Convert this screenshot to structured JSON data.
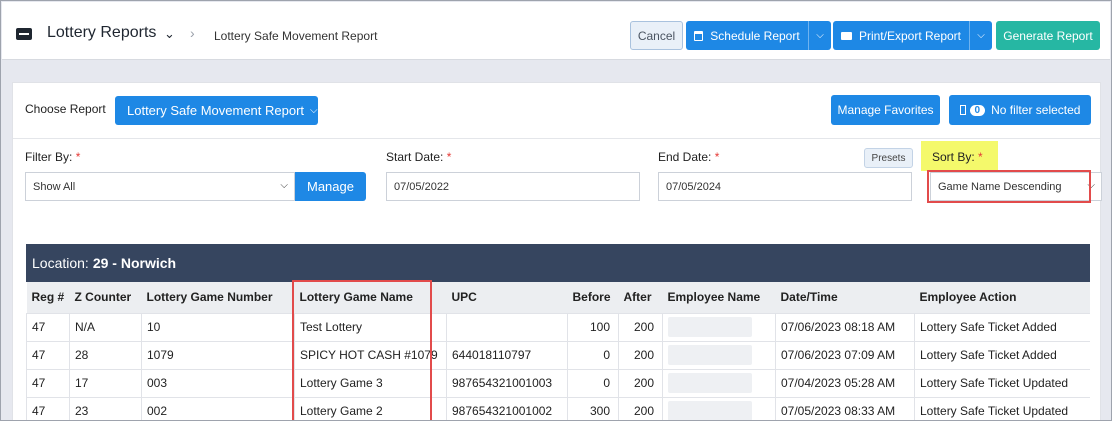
{
  "header": {
    "app_title": "Lottery Reports",
    "breadcrumb": "Lottery Safe Movement Report",
    "cancel_label": "Cancel",
    "schedule_label": "Schedule Report",
    "print_label": "Print/Export Report",
    "generate_label": "Generate Report"
  },
  "toolbar": {
    "choose_label": "Choose Report",
    "report_selected": "Lottery Safe Movement Report",
    "favorites_label": "Manage Favorites",
    "filter_count": "0",
    "filter_label": "No filter selected"
  },
  "filters": {
    "filter_by_label": "Filter By:",
    "filter_by_value": "Show All",
    "manage_label": "Manage",
    "start_label": "Start Date:",
    "start_value": "07/05/2022",
    "end_label": "End Date:",
    "end_value": "07/05/2024",
    "presets_label": "Presets",
    "sort_label": "Sort By:",
    "sort_value": "Game Name Descending",
    "required_mark": "*"
  },
  "table": {
    "location_label": "Location:",
    "location_value": "29 - Norwich",
    "columns": [
      "Reg #",
      "Z Counter",
      "Lottery Game Number",
      "Lottery Game Name",
      "UPC",
      "Before",
      "After",
      "Employee Name",
      "Date/Time",
      "Employee Action"
    ],
    "rows": [
      [
        "47",
        "N/A",
        "10",
        "Test Lottery",
        "",
        "100",
        "200",
        "",
        "07/06/2023 08:18 AM",
        "Lottery Safe Ticket Added"
      ],
      [
        "47",
        "28",
        "1079",
        "SPICY HOT CASH #1079",
        "644018110797",
        "0",
        "200",
        "",
        "07/06/2023 07:09 AM",
        "Lottery Safe Ticket Added"
      ],
      [
        "47",
        "17",
        "003",
        "Lottery Game 3",
        "987654321001003",
        "0",
        "200",
        "",
        "07/04/2023 05:28 AM",
        "Lottery Safe Ticket Updated"
      ],
      [
        "47",
        "23",
        "002",
        "Lottery Game 2",
        "987654321001002",
        "300",
        "200",
        "",
        "07/05/2023 08:33 AM",
        "Lottery Safe Ticket Updated"
      ]
    ]
  },
  "colors": {
    "accent": "#1e88e5",
    "generate": "#26b7a3",
    "header_bar": "#36455f",
    "highlight": "#f4f96b",
    "annotation": "#e24b4b"
  }
}
